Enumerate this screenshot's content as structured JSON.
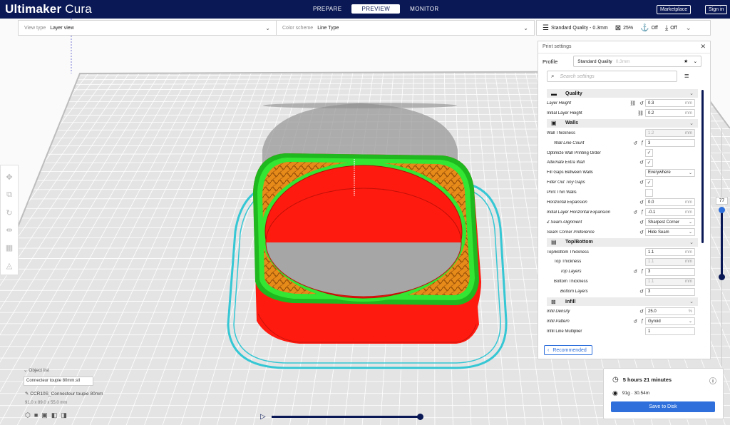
{
  "app": {
    "brand_bold": "Ultimaker",
    "brand_light": "Cura"
  },
  "stages": [
    {
      "label": "PREPARE"
    },
    {
      "label": "PREVIEW"
    },
    {
      "label": "MONITOR"
    }
  ],
  "header_buttons": {
    "marketplace": "Marketplace",
    "signin": "Sign in"
  },
  "viewbar": {
    "view_type_label": "View type",
    "view_type_value": "Layer view",
    "color_scheme_label": "Color scheme",
    "color_scheme_value": "Line Type"
  },
  "setbar": {
    "quality": "Standard Quality - 0.3mm",
    "infill": "25%",
    "support": "Off",
    "adhesion": "Off"
  },
  "panel": {
    "title": "Print settings",
    "profile_label": "Profile",
    "profile_value": "Standard Quality",
    "profile_hint": "0.3mm",
    "search_placeholder": "Search settings",
    "recommended": "Recommended"
  },
  "categories": {
    "quality": "Quality",
    "walls": "Walls",
    "topbottom": "Top/Bottom",
    "infill": "Infill"
  },
  "settings": {
    "layer_height": {
      "label": "Layer Height",
      "value": "0.3",
      "unit": "mm"
    },
    "initial_layer_height": {
      "label": "Initial Layer Height",
      "value": "0.2",
      "unit": "mm"
    },
    "wall_thickness": {
      "label": "Wall Thickness",
      "value": "1.2",
      "unit": "mm"
    },
    "wall_line_count": {
      "label": "Wall Line Count",
      "value": "3"
    },
    "optimize_wall": {
      "label": "Optimize Wall Printing Order",
      "check": "✓"
    },
    "alternate_extra_wall": {
      "label": "Alternate Extra Wall",
      "check": "✓"
    },
    "fill_gaps": {
      "label": "Fill Gaps Between Walls",
      "value": "Everywhere"
    },
    "filter_tiny_gaps": {
      "label": "Filter Out Tiny Gaps",
      "check": "✓"
    },
    "print_thin_walls": {
      "label": "Print Thin Walls",
      "check": ""
    },
    "horizontal_expansion": {
      "label": "Horizontal Expansion",
      "value": "0.0",
      "unit": "mm"
    },
    "initial_layer_horizontal_expansion": {
      "label": "Initial Layer Horizontal Expansion",
      "value": "-0.1",
      "unit": "mm"
    },
    "z_seam_alignment": {
      "label": "Z Seam Alignment",
      "value": "Sharpest Corner"
    },
    "seam_corner_preference": {
      "label": "Seam Corner Preference",
      "value": "Hide Seam"
    },
    "topbottom_thickness": {
      "label": "Top/Bottom Thickness",
      "value": "1.1",
      "unit": "mm"
    },
    "top_thickness": {
      "label": "Top Thickness",
      "value": "1.1",
      "unit": "mm"
    },
    "top_layers": {
      "label": "Top Layers",
      "value": "3"
    },
    "bottom_thickness": {
      "label": "Bottom Thickness",
      "value": "1.1",
      "unit": "mm"
    },
    "bottom_layers": {
      "label": "Bottom Layers",
      "value": "3"
    },
    "infill_density": {
      "label": "Infill Density",
      "value": "25.0",
      "unit": "%"
    },
    "infill_pattern": {
      "label": "Infill Pattern",
      "value": "Gyroid"
    },
    "infill_line_multiplier": {
      "label": "Infill Line Multiplier",
      "value": "1"
    }
  },
  "layer_slider": {
    "value": "77"
  },
  "object": {
    "list_label": "Object list",
    "file": "Connecteur toupie 80mm.stl",
    "name": "CCR10S_Connecteur toupie 80mm",
    "dims": "91.0 x 89.0 x 55.0 mm"
  },
  "print_info": {
    "time": "5 hours 21 minutes",
    "material": "91g · 30.54m",
    "save": "Save to Disk"
  },
  "colors": {
    "header": "#0a1855",
    "accent": "#2e6fdc",
    "wall_red": "#ff1a0f",
    "infill_orange": "#e68a1a",
    "skin_green": "#33e633",
    "skirt_cyan": "#35c7d4"
  }
}
